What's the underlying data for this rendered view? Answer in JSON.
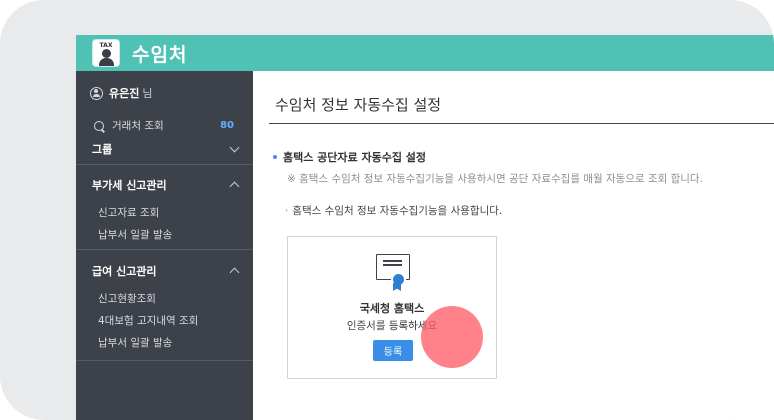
{
  "app": {
    "title": "수임처",
    "logo_text": "TAX"
  },
  "sidebar": {
    "user": {
      "name": "유은진",
      "suffix": "님"
    },
    "search": {
      "label": "거래처 조회",
      "count": "80"
    },
    "group": {
      "label": "그룹"
    },
    "sections": [
      {
        "title": "부가세 신고관리",
        "items": [
          "신고자료 조회",
          "납부서 일괄 발송"
        ]
      },
      {
        "title": "급여 신고관리",
        "items": [
          "신고현황조회",
          "4대보험 고지내역 조회",
          "납부서 일괄 발송"
        ]
      }
    ]
  },
  "main": {
    "page_title": "수임처 정보 자동수집 설정",
    "section_heading": "홈택스 공단자료 자동수집 설정",
    "note": "※ 홈택스 수임처 정보 자동수집기능을 사용하시면 공단 자료수집를 매월 자동으로 조회 합니다.",
    "usage": "홈택스 수임처 정보 자동수집기능을 사용합니다.",
    "card": {
      "title": "국세청 홈택스",
      "desc_prefix": "인증서를 ",
      "desc_link": "등록하세요",
      "button": "등록"
    }
  },
  "colors": {
    "header": "#4fc2b5",
    "sidebar": "#3d424a",
    "accent": "#3a8ee8",
    "count": "#5fb0ff",
    "touch_indicator": "#ff5f69"
  },
  "icons": {
    "user": "user-circle-icon",
    "search": "search-icon",
    "chevron_down": "chevron-down-icon",
    "chevron_up": "chevron-up-icon",
    "certificate": "certificate-icon"
  }
}
